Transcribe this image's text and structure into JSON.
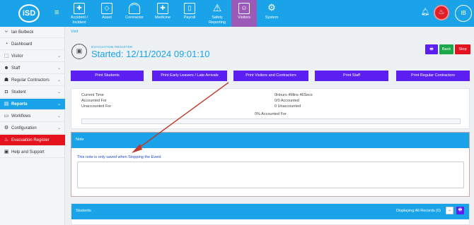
{
  "topbar": {
    "logo_text": "iSD",
    "nav": [
      {
        "label": "Accident / Incident",
        "icon": "first-aid-icon"
      },
      {
        "label": "Asset",
        "icon": "tag-icon"
      },
      {
        "label": "Contractor",
        "icon": "hardhat-icon"
      },
      {
        "label": "Medicine",
        "icon": "medkit-icon"
      },
      {
        "label": "Payroll",
        "icon": "payroll-icon"
      },
      {
        "label": "Safety Reporting",
        "icon": "warning-icon"
      },
      {
        "label": "Visitors",
        "icon": "visitor-icon"
      },
      {
        "label": "System",
        "icon": "gear-icon"
      }
    ],
    "avatar_initials": "IB",
    "active_color": "#9c5ab8",
    "bar_color": "#1aa3e8"
  },
  "sidebar": {
    "items": [
      {
        "label": "Ian Bulbeck",
        "icon": "user-switch-icon",
        "chevron": false
      },
      {
        "label": "Dashboard",
        "icon": "dashboard-icon",
        "chevron": false
      },
      {
        "label": "Visitor",
        "icon": "visitor-icon",
        "chevron": true
      },
      {
        "label": "Staff",
        "icon": "staff-icon",
        "chevron": true
      },
      {
        "label": "Regular Contractors",
        "icon": "contractors-icon",
        "chevron": true
      },
      {
        "label": "Student",
        "icon": "student-icon",
        "chevron": true
      },
      {
        "label": "Reports",
        "icon": "reports-icon",
        "chevron": true
      },
      {
        "label": "Workflows",
        "icon": "workflow-icon",
        "chevron": true
      },
      {
        "label": "Configuration",
        "icon": "configuration-icon",
        "chevron": true
      },
      {
        "label": "Evacuation Register",
        "icon": "fire-icon",
        "chevron": false
      },
      {
        "label": "Help and Support",
        "icon": "help-icon",
        "chevron": false
      }
    ]
  },
  "breadcrumb": "Visit",
  "evacuation": {
    "subtitle": "EVACUATION REGISTER",
    "title": "Started: 12/11/2024 09:01:10",
    "buttons": {
      "print": "🖶",
      "back": "Back",
      "stop": "Stop"
    }
  },
  "print_buttons": [
    "Print Students",
    "Print Early Leavers / Late Arrivals",
    "Print Visitors and Contractors",
    "Print Staff",
    "Print Regular Contractors"
  ],
  "stats": {
    "current_time_label": "Current Time",
    "accounted_for_label": "Accounted For",
    "unaccounted_for_label": "Unaccounted For",
    "current_time_value": "0Hours 4Mins 46Secs",
    "accounted_for_value": "0/0 Accounted",
    "unaccounted_for_value": "0 Unaccounted",
    "progress_label": "0% Accounted For",
    "progress_percent": 0
  },
  "note": {
    "header": "Note",
    "message": "This note is only saved when Stopping the Event"
  },
  "students": {
    "header": "Students",
    "display_text": "Displaying All Records (0)",
    "minus": "−",
    "print": "🖶"
  }
}
